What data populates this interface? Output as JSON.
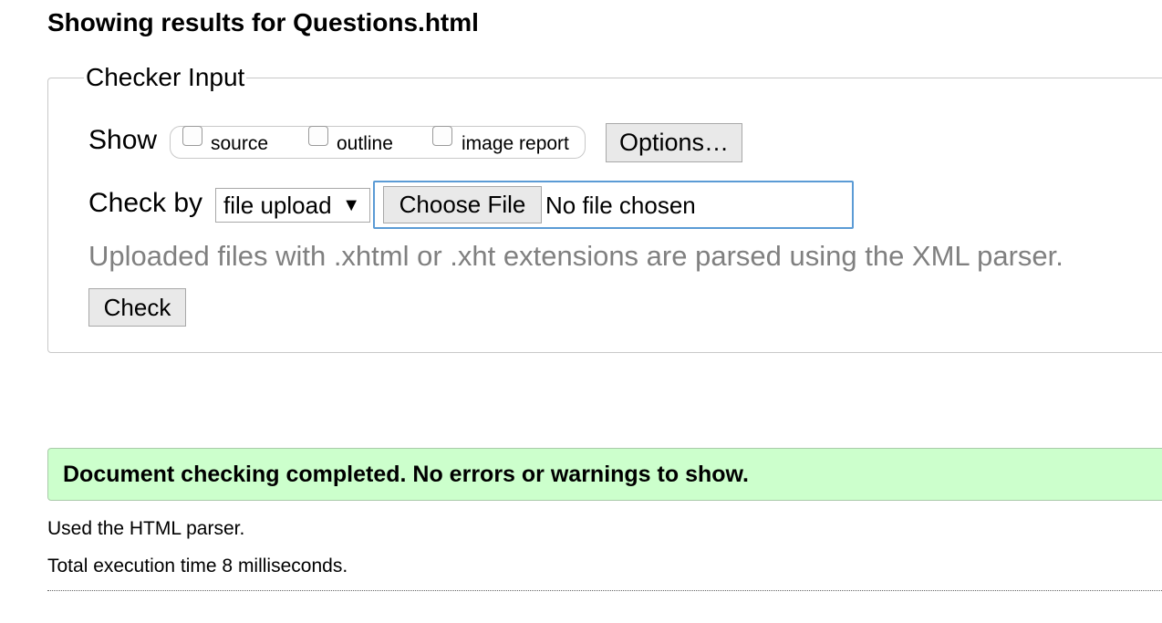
{
  "page": {
    "title": "Showing results for Questions.html"
  },
  "checker": {
    "legend": "Checker Input",
    "show_label": "Show",
    "checkboxes": [
      {
        "label": "source",
        "checked": false
      },
      {
        "label": "outline",
        "checked": false
      },
      {
        "label": "image report",
        "checked": false
      }
    ],
    "options_button": "Options…",
    "check_by_label": "Check by",
    "check_by_selected": "file upload",
    "select_arrow_icon": "triangle-down",
    "choose_file_button": "Choose File",
    "file_status": "No file chosen",
    "hint": "Uploaded files with .xhtml or .xht extensions are parsed using the XML parser.",
    "check_button": "Check"
  },
  "results": {
    "message": "Document checking completed. No errors or warnings to show.",
    "message_bg": "#ccffcc",
    "parser_info": "Used the HTML parser.",
    "execution_time": "Total execution time 8 milliseconds."
  }
}
